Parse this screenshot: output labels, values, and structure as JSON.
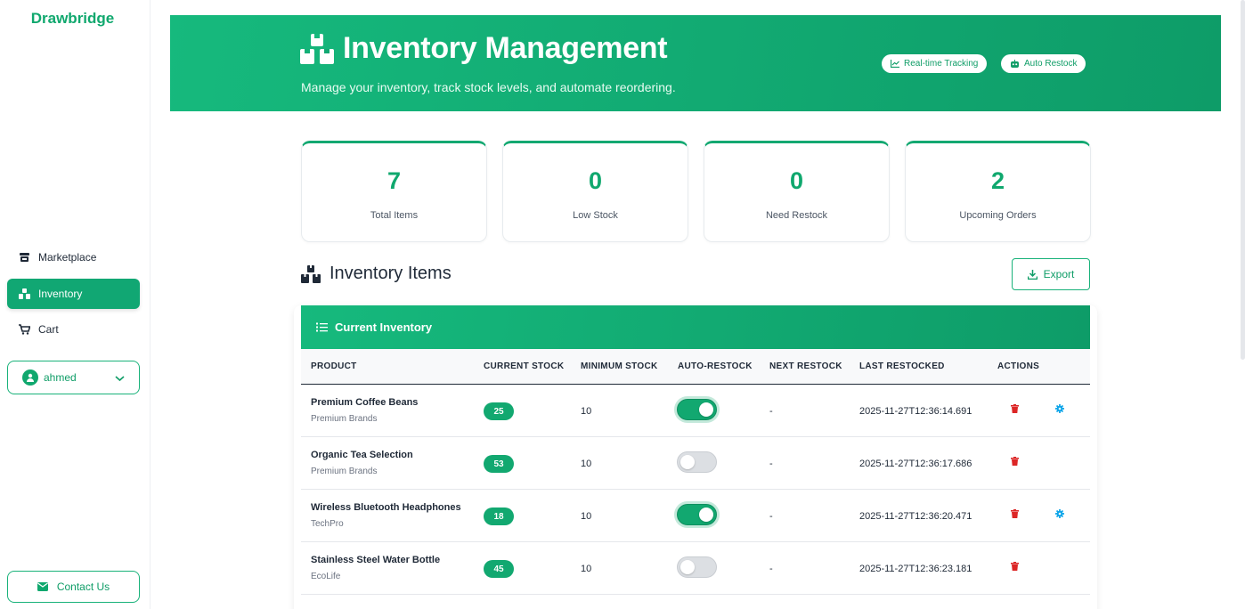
{
  "sidebar": {
    "brand": "Drawbridge",
    "nav": [
      {
        "label": "Marketplace",
        "icon": "store-icon",
        "active": false
      },
      {
        "label": "Inventory",
        "icon": "boxes-icon",
        "active": true
      },
      {
        "label": "Cart",
        "icon": "cart-icon",
        "active": false
      }
    ],
    "user": {
      "name": "ahmed",
      "icon": "user-circle-icon"
    },
    "contact_label": "Contact Us"
  },
  "hero": {
    "title": "Inventory Management",
    "subtitle": "Manage your inventory, track stock levels, and automate reordering.",
    "badges": [
      "Real-time Tracking",
      "Auto Restock"
    ]
  },
  "stats": [
    {
      "value": "7",
      "label": "Total Items"
    },
    {
      "value": "0",
      "label": "Low Stock"
    },
    {
      "value": "0",
      "label": "Need Restock"
    },
    {
      "value": "2",
      "label": "Upcoming Orders"
    }
  ],
  "section": {
    "title": "Inventory Items",
    "export_label": "Export"
  },
  "table": {
    "title": "Current Inventory",
    "columns": [
      "PRODUCT",
      "CURRENT STOCK",
      "MINIMUM STOCK",
      "AUTO-RESTOCK",
      "NEXT RESTOCK",
      "LAST RESTOCKED",
      "ACTIONS"
    ],
    "rows": [
      {
        "name": "Premium Coffee Beans",
        "brand": "Premium Brands",
        "stock": "25",
        "min": "10",
        "auto_restock": true,
        "next": "-",
        "last": "2025-11-27T12:36:14.691",
        "has_settings": true
      },
      {
        "name": "Organic Tea Selection",
        "brand": "Premium Brands",
        "stock": "53",
        "min": "10",
        "auto_restock": false,
        "next": "-",
        "last": "2025-11-27T12:36:17.686",
        "has_settings": false
      },
      {
        "name": "Wireless Bluetooth Headphones",
        "brand": "TechPro",
        "stock": "18",
        "min": "10",
        "auto_restock": true,
        "next": "-",
        "last": "2025-11-27T12:36:20.471",
        "has_settings": true
      },
      {
        "name": "Stainless Steel Water Bottle",
        "brand": "EcoLife",
        "stock": "45",
        "min": "10",
        "auto_restock": false,
        "next": "-",
        "last": "2025-11-27T12:36:23.181",
        "has_settings": false
      }
    ]
  },
  "colors": {
    "accent": "#10a86e",
    "danger": "#dc2626",
    "info": "#0ea5e9"
  }
}
